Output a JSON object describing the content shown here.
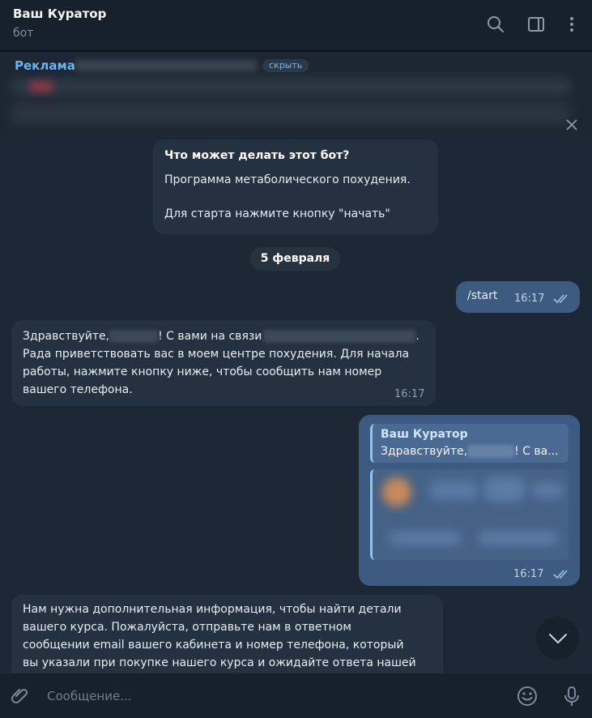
{
  "header": {
    "title": "Ваш Куратор",
    "subtitle": "бот",
    "icons": [
      "search-icon",
      "sidebar-toggle-icon",
      "more-vertical-icon"
    ]
  },
  "ad": {
    "label": "Реклама",
    "hide_label": "скрыть",
    "close_icon": "close-icon"
  },
  "bot_info": {
    "title": "Что может делать этот бот?",
    "line1": "Программа метаболического похудения.",
    "line2": "Для старта нажмите кнопку \"начать\""
  },
  "date_separator": "5 февраля",
  "messages": [
    {
      "direction": "out",
      "text": "/start",
      "time": "16:17",
      "status": "read"
    },
    {
      "direction": "in",
      "text_parts": [
        "Здравствуйте,",
        "! С вами на связи",
        ".",
        "Рада приветствовать вас в моем центре похудения. Для начала",
        "работы, нажмите кнопку ниже, чтобы сообщить нам номер",
        "вашего телефона."
      ],
      "time": "16:17"
    },
    {
      "direction": "out",
      "reply_name": "Ваш Куратор",
      "reply_prefix": "Здравствуйте,",
      "reply_suffix": "! С ва...",
      "time": "16:17",
      "status": "read"
    },
    {
      "direction": "in",
      "lines": [
        "Нам нужна дополнительная информация, чтобы найти детали",
        "вашего курса. Пожалуйста, отправьте нам в ответном",
        "сообщении email вашего кабинета и номер телефона, который",
        "вы указали  при покупке нашего курса и ожидайте ответа нашей"
      ]
    }
  ],
  "composer": {
    "placeholder": "Сообщение...",
    "icons": [
      "attach-icon",
      "emoji-icon",
      "microphone-icon"
    ]
  },
  "colors": {
    "accent": "#6ab3f3",
    "outgoing_bubble": "#3d5a80",
    "incoming_bubble": "#233140",
    "background": "#1c2836"
  }
}
